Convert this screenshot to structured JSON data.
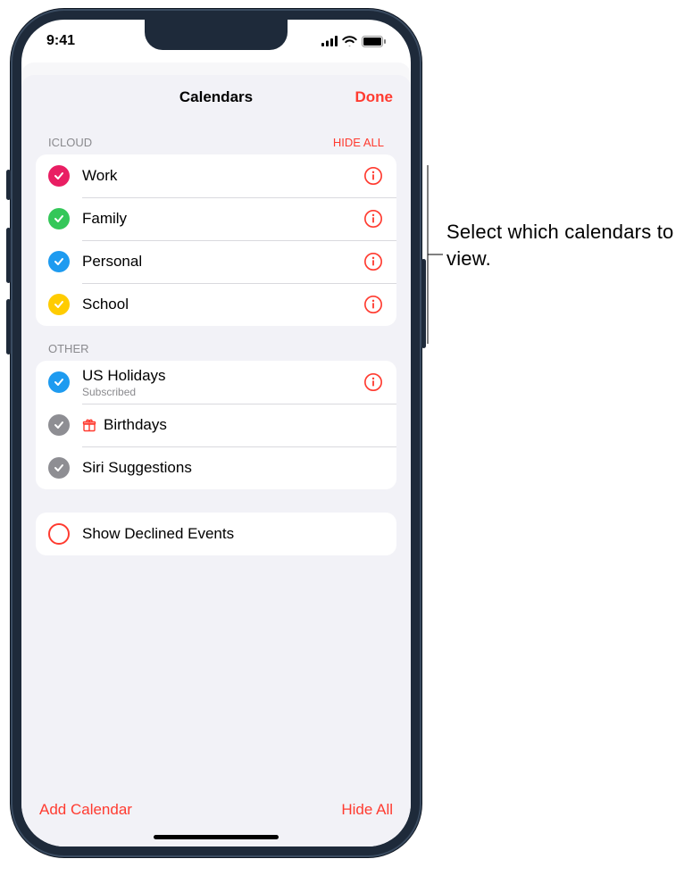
{
  "status_bar": {
    "time": "9:41"
  },
  "sheet": {
    "title": "Calendars",
    "done_label": "Done"
  },
  "sections": {
    "icloud": {
      "header": "ICLOUD",
      "hide_all_label": "HIDE ALL",
      "items": [
        {
          "label": "Work",
          "color": "#e91e63"
        },
        {
          "label": "Family",
          "color": "#34c759"
        },
        {
          "label": "Personal",
          "color": "#1e9bf0"
        },
        {
          "label": "School",
          "color": "#ffcc00"
        }
      ]
    },
    "other": {
      "header": "OTHER",
      "items": [
        {
          "label": "US Holidays",
          "sub": "Subscribed",
          "color": "#1e9bf0",
          "info": true
        },
        {
          "label": "Birthdays",
          "color": "#8e8e93",
          "gift": true
        },
        {
          "label": "Siri Suggestions",
          "color": "#8e8e93"
        }
      ]
    }
  },
  "declined": {
    "label": "Show Declined Events"
  },
  "bottom": {
    "add_label": "Add Calendar",
    "hide_all_label": "Hide All"
  },
  "callout": {
    "text": "Select which calendars to view."
  }
}
